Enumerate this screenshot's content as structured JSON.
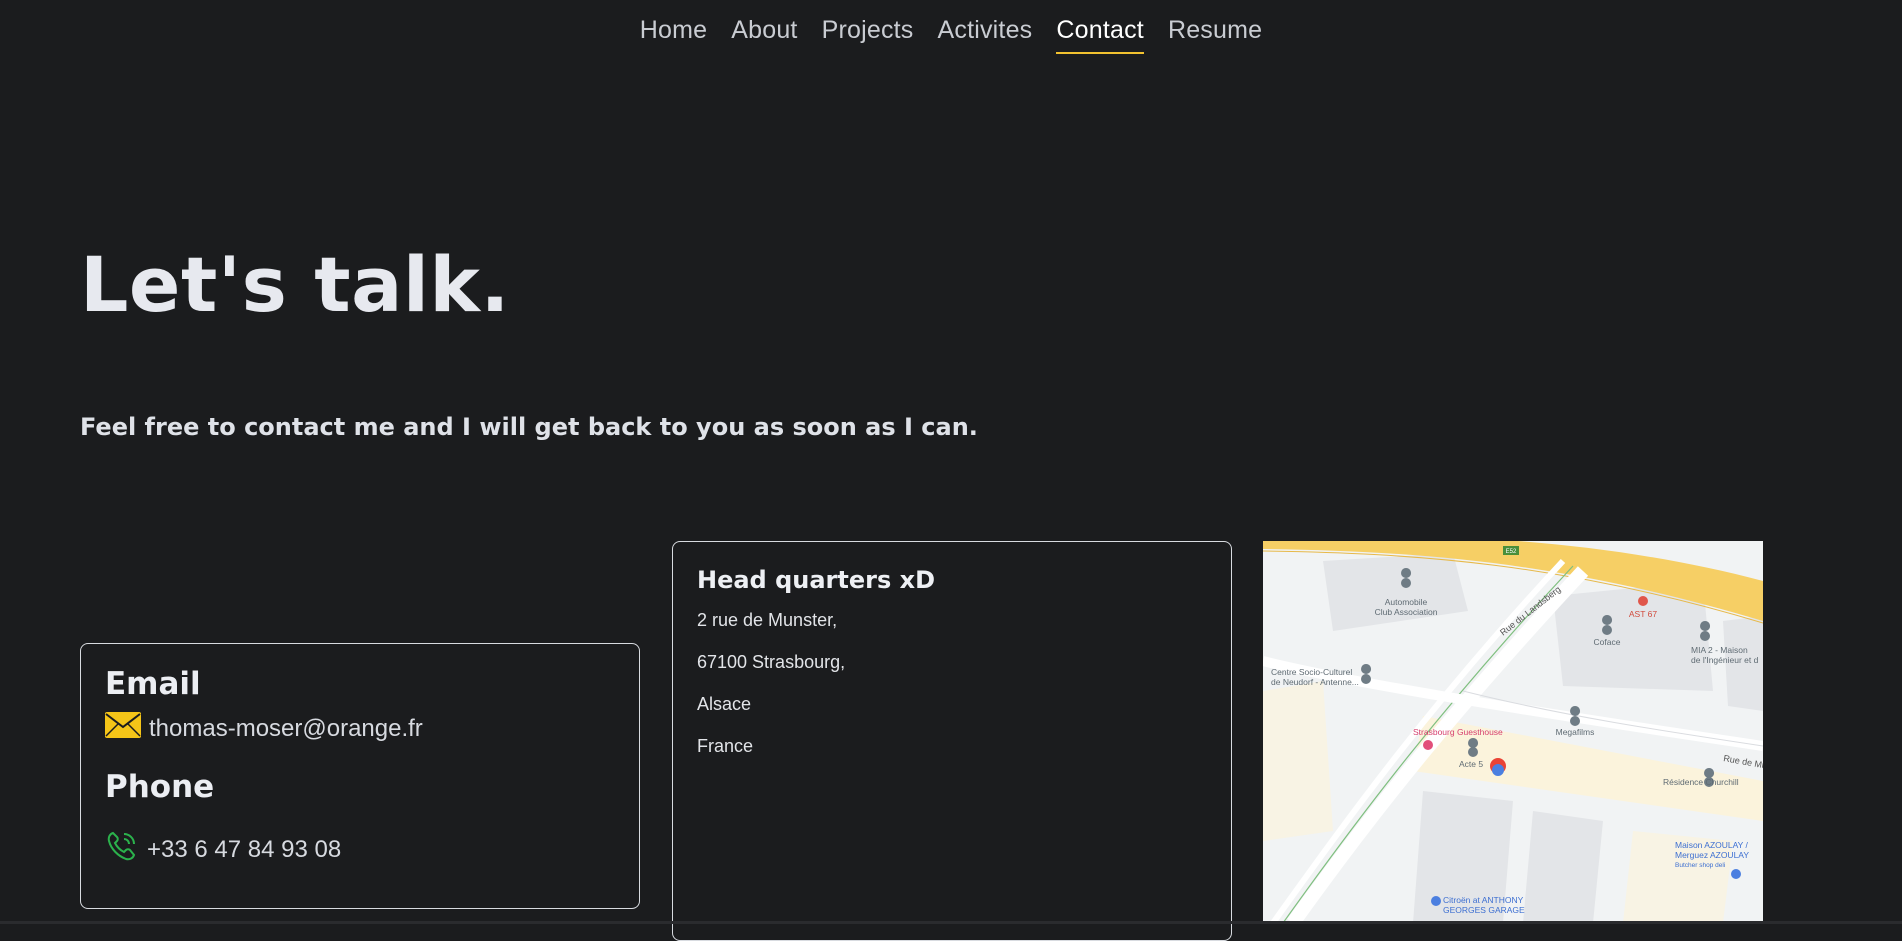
{
  "nav": {
    "items": [
      {
        "label": "Home"
      },
      {
        "label": "About"
      },
      {
        "label": "Projects"
      },
      {
        "label": "Activites"
      },
      {
        "label": "Contact"
      },
      {
        "label": "Resume"
      }
    ],
    "active": "Contact",
    "accent_color": "#f2c230"
  },
  "hero": {
    "title": "Let's talk.",
    "subtitle": "Feel free to contact me and I will get back to you as soon as I can."
  },
  "contact": {
    "email_title": "Email",
    "email_value": "thomas-moser@orange.fr",
    "email_icon": "envelope-icon",
    "phone_title": "Phone",
    "phone_value": "+33 6 47 84 93 08",
    "phone_icon": "phone-icon"
  },
  "hq": {
    "title": "Head quarters xD",
    "lines": [
      "2 rue de Munster,",
      "67100 Strasbourg,",
      "Alsace",
      "France"
    ]
  },
  "map": {
    "labels": {
      "road1": "Rue du Landsberg",
      "road2": "Rue de Mu",
      "poi1": "Automobile",
      "poi1b": "Club Association",
      "poi2": "AST 67",
      "poi3": "Coface",
      "poi4": "MIA 2 - Maison",
      "poi4b": "de l'Ingénieur et d",
      "poi5": "Centre Socio-Culturel",
      "poi5b": "de Neudorf - Antenne...",
      "poi6": "Megafilms",
      "poi7": "Strasbourg Guesthouse",
      "poi8": "Acte 5",
      "poi9": "Résidence Churchill",
      "poi10": "Maison AZOULAY /",
      "poi10b": "Merguez AZOULAY",
      "poi10c": "Butcher shop deli",
      "poi11": "Citroën at ANTHONY",
      "poi11b": "GEORGES GARAGE",
      "shield": "E52"
    }
  }
}
